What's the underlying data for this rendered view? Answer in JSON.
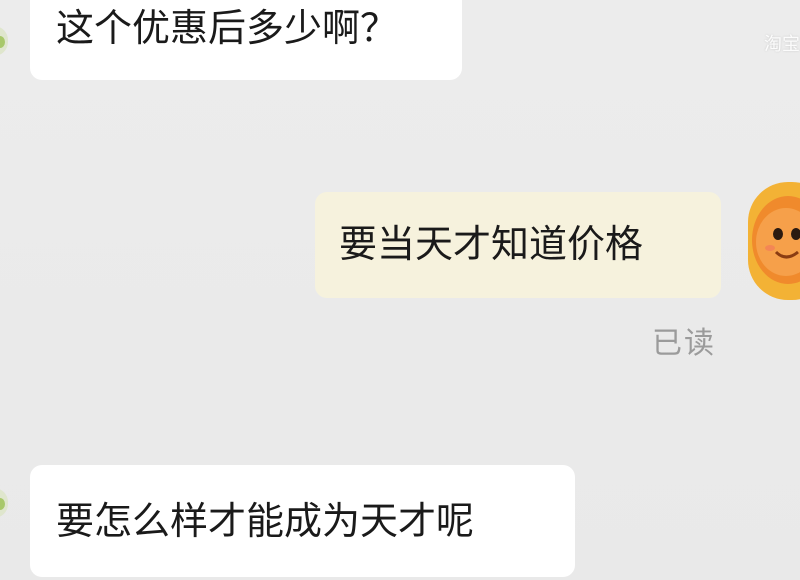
{
  "messages": [
    {
      "side": "incoming",
      "text": "这个优惠后多少啊？"
    },
    {
      "side": "outgoing",
      "text": "要当天才知道价格",
      "status": "已读"
    },
    {
      "side": "incoming",
      "text": "要怎么样才能成为天才呢"
    }
  ],
  "watermark": "淘宝",
  "colors": {
    "background": "#ebebeb",
    "incoming_bubble": "#ffffff",
    "outgoing_bubble": "#f6f2dd",
    "status_text": "#9b9b9b",
    "avatar_orange": "#f3b235"
  },
  "icons": {
    "left_avatar": "user-avatar-icon",
    "right_avatar": "mascot-avatar-icon"
  }
}
